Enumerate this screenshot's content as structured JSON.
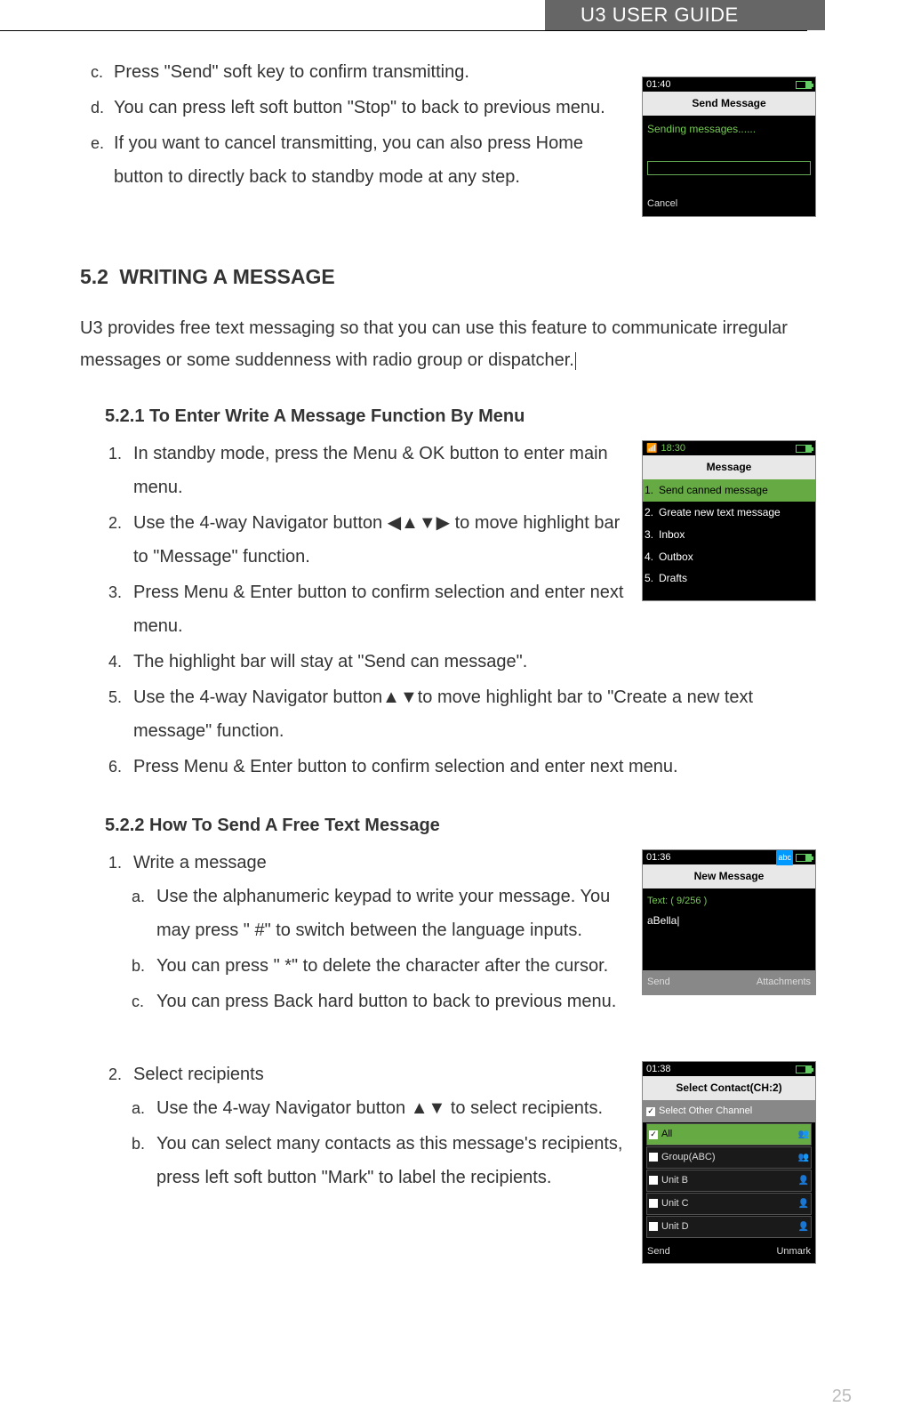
{
  "header": {
    "title": "U3 USER GUIDE"
  },
  "top_list": {
    "c": "Press \"Send\" soft key to confirm transmitting.",
    "d": "You can press left soft button \"Stop\" to back to previous menu.",
    "e": "If you want to cancel transmitting, you can also press Home button to directly back to standby mode at any step."
  },
  "screen1": {
    "time": "01:40",
    "title": "Send Message",
    "status": "Sending messages......",
    "softkey_left": "Cancel"
  },
  "section": {
    "number": "5.2",
    "title": "WRITING A MESSAGE",
    "intro": "U3 provides free text messaging so that you can use this feature to communicate irregular messages or some suddenness with radio group or dispatcher."
  },
  "sub1": {
    "title": "5.2.1 To Enter Write A Message Function By Menu",
    "items": {
      "i1": "In standby mode, press the Menu & OK button to enter main menu.",
      "i2a": "Use the 4-way Navigator button ",
      "i2_arrows": "◀▲▼▶",
      "i2b": " to move highlight bar to \"Message\" function.",
      "i3": "Press Menu & Enter button to confirm selection and enter next menu.",
      "i4": "The highlight bar will stay at \"Send can message\".",
      "i5a": "Use the 4-way Navigator button",
      "i5_arrows": "▲▼",
      "i5b": "to move highlight bar to \"Create a new text message\" function.",
      "i6": "Press Menu & Enter button to confirm selection and enter next menu."
    }
  },
  "screen2": {
    "time": "18:30",
    "signal": "📶",
    "title": "Message",
    "menu": [
      {
        "n": "1.",
        "t": "Send canned message"
      },
      {
        "n": "2.",
        "t": "Greate new text message"
      },
      {
        "n": "3.",
        "t": "Inbox"
      },
      {
        "n": "4.",
        "t": "Outbox"
      },
      {
        "n": "5.",
        "t": "Drafts"
      }
    ]
  },
  "sub2": {
    "title": "5.2.2 How To Send A Free Text Message",
    "i1": "Write a message",
    "i1a": "Use the alphanumeric keypad to write your message. You may press \" #\" to switch between the language inputs.",
    "i1b": "You can press \" *\" to delete the character after the cursor.",
    "i1c": "You can press Back hard button to back to previous menu.",
    "i2": "Select recipients",
    "i2a_pre": "Use the 4-way Navigator button ",
    "i2a_arrows": "▲▼",
    "i2a_post": " to select recipients.",
    "i2b": "You can select many contacts as this message's recipients, press left soft button \"Mark\" to label the recipients."
  },
  "screen3": {
    "time": "01:36",
    "mode": "abc",
    "title": "New Message",
    "counter": "Text: ( 9/256 )",
    "body": "aBella",
    "softkey_left": "Send",
    "softkey_right": "Attachments"
  },
  "screen4": {
    "time": "01:38",
    "title": "Select Contact(CH:2)",
    "header": "Select Other Channel",
    "rows": [
      {
        "name": "All",
        "icon": "👥",
        "sel": true
      },
      {
        "name": "Group(ABC)",
        "icon": "👥"
      },
      {
        "name": "Unit B",
        "icon": "👤"
      },
      {
        "name": "Unit C",
        "icon": "👤"
      },
      {
        "name": "Unit D",
        "icon": "👤"
      }
    ],
    "softkey_left": "Send",
    "softkey_right": "Unmark"
  },
  "page_number": "25"
}
